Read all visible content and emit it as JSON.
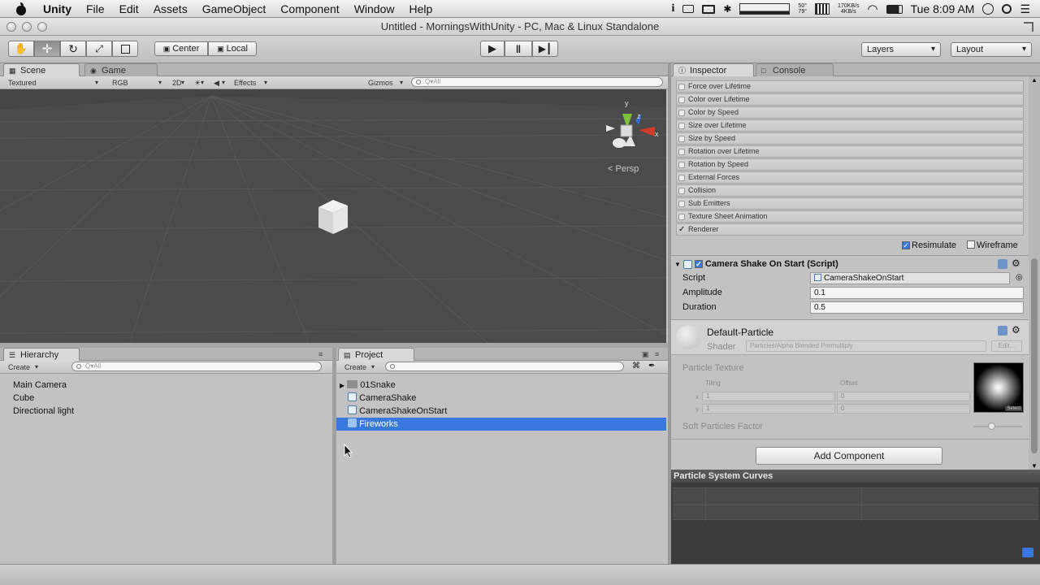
{
  "menubar": {
    "app": "Unity",
    "items": [
      "File",
      "Edit",
      "Assets",
      "GameObject",
      "Component",
      "Window",
      "Help"
    ],
    "net_up": "170KB/s",
    "net_down": "4KB/s",
    "temp_a": "50°",
    "temp_b": "79°",
    "clock": "Tue 8:09 AM"
  },
  "window": {
    "title": "Untitled - MorningsWithUnity - PC, Mac & Linux Standalone"
  },
  "toolbar": {
    "pivot_center": "Center",
    "pivot_local": "Local",
    "layers": "Layers",
    "layout": "Layout"
  },
  "scene": {
    "tab_scene": "Scene",
    "tab_game": "Game",
    "render_mode": "Textured",
    "color_mode": "RGB",
    "mode_2d": "2D",
    "effects": "Effects",
    "gizmos": "Gizmos",
    "search_placeholder": "Q▾All",
    "persp": "Persp",
    "axis_y": "y",
    "axis_z": "z",
    "axis_x": "x"
  },
  "hierarchy": {
    "tab": "Hierarchy",
    "create": "Create",
    "search_placeholder": "Q▾All",
    "items": [
      "Main Camera",
      "Cube",
      "Directional light"
    ]
  },
  "project": {
    "tab": "Project",
    "create": "Create",
    "items": [
      {
        "label": "01Snake",
        "icon": "folder-icon",
        "selected": false
      },
      {
        "label": "CameraShake",
        "icon": "script-icon",
        "selected": false
      },
      {
        "label": "CameraShakeOnStart",
        "icon": "script-icon",
        "selected": false
      },
      {
        "label": "Fireworks",
        "icon": "prefab-icon",
        "selected": true
      }
    ]
  },
  "inspector": {
    "tab_inspector": "Inspector",
    "tab_console": "Console",
    "modules": [
      {
        "label": "Force over Lifetime",
        "checked": false
      },
      {
        "label": "Color over Lifetime",
        "checked": false
      },
      {
        "label": "Color by Speed",
        "checked": false
      },
      {
        "label": "Size over Lifetime",
        "checked": false
      },
      {
        "label": "Size by Speed",
        "checked": false
      },
      {
        "label": "Rotation over Lifetime",
        "checked": false
      },
      {
        "label": "Rotation by Speed",
        "checked": false
      },
      {
        "label": "External Forces",
        "checked": false
      },
      {
        "label": "Collision",
        "checked": false
      },
      {
        "label": "Sub Emitters",
        "checked": false
      },
      {
        "label": "Texture Sheet Animation",
        "checked": false
      },
      {
        "label": "Renderer",
        "checked": true
      }
    ],
    "resimulate": "Resimulate",
    "wireframe": "Wireframe",
    "component_title": "Camera Shake On Start (Script)",
    "script_label": "Script",
    "script_value": "CameraShakeOnStart",
    "amplitude_label": "Amplitude",
    "amplitude_value": "0.1",
    "duration_label": "Duration",
    "duration_value": "0.5",
    "material_name": "Default-Particle",
    "shader_label": "Shader",
    "shader_value": "Particles/Alpha Blended Premultiply",
    "edit_button": "Edit...",
    "particle_texture": "Particle Texture",
    "tiling": "Tiling",
    "offset": "Offset",
    "x_label": "x",
    "y_label": "y",
    "tiling_x": "1",
    "tiling_y": "1",
    "offset_x": "0",
    "offset_y": "0",
    "texture_thumb_label": "Select",
    "soft_particles": "Soft Particles Factor",
    "add_component": "Add Component"
  },
  "curves": {
    "title": "Particle System Curves"
  }
}
